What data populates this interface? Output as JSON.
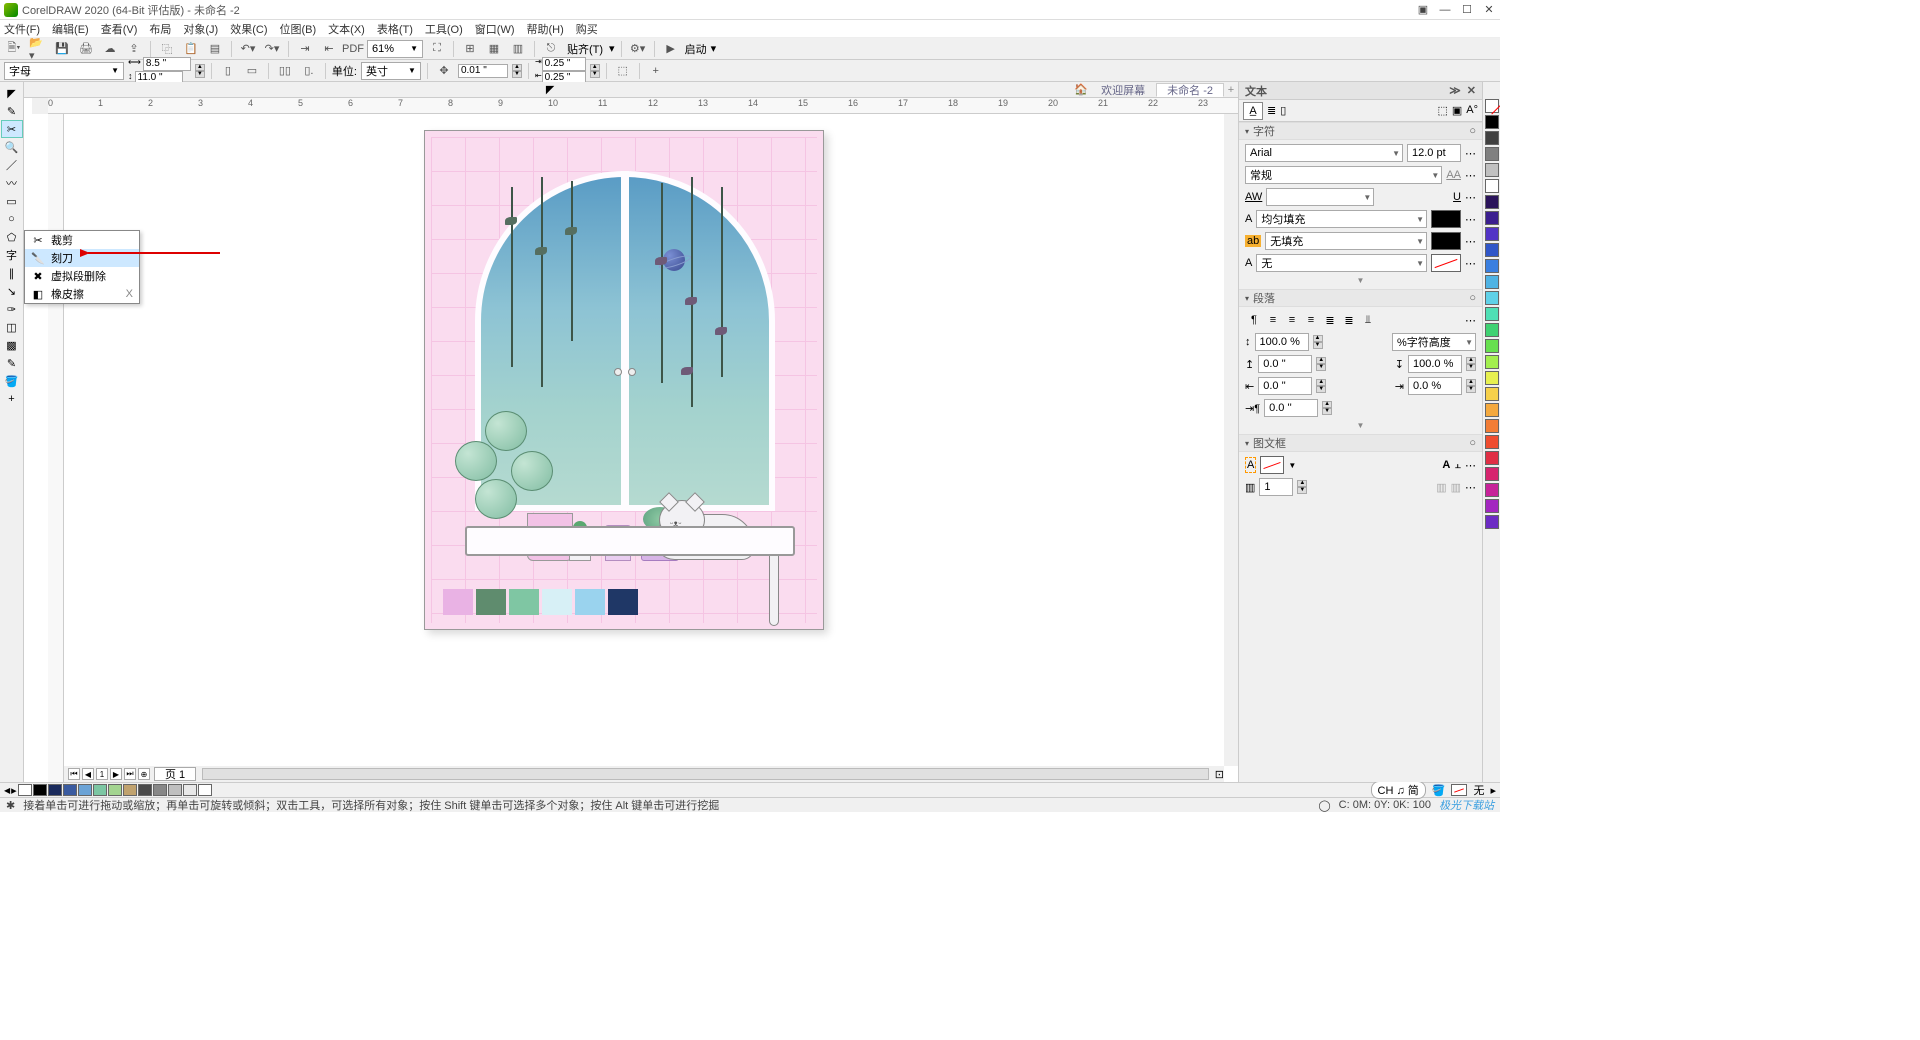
{
  "title": "CorelDRAW 2020 (64-Bit 评估版) - 未命名 -2",
  "menus": [
    "文件(F)",
    "编辑(E)",
    "查看(V)",
    "布局",
    "对象(J)",
    "效果(C)",
    "位图(B)",
    "文本(X)",
    "表格(T)",
    "工具(O)",
    "窗口(W)",
    "帮助(H)",
    "购买"
  ],
  "zoom": "61%",
  "align_label": "贴齐(T)",
  "start_label": "启动",
  "papersize_label": "字母",
  "width": "8.5 \"",
  "height": "11.0 \"",
  "units_label": "单位:",
  "units_value": "英寸",
  "nudge": "0.01 \"",
  "dup_x": "0.25 \"",
  "dup_y": "0.25 \"",
  "tabs": {
    "welcome": "欢迎屏幕",
    "doc": "未命名 -2"
  },
  "flyout": {
    "crop": "裁剪",
    "knife": "刻刀",
    "vdelete": "虚拟段删除",
    "eraser": "橡皮擦",
    "eraser_key": "X"
  },
  "ruler_marks": [
    "0",
    "1",
    "2",
    "3",
    "4",
    "5",
    "6",
    "7",
    "8",
    "9",
    "10",
    "11",
    "12",
    "13",
    "14",
    "15",
    "16",
    "17",
    "18",
    "19",
    "20",
    "21",
    "22",
    "23"
  ],
  "page_tab": "页 1",
  "right": {
    "docker_title": "文本",
    "sec_char": "字符",
    "font": "Arial",
    "font_size": "12.0 pt",
    "font_weight": "常规",
    "kern_label": "AW",
    "fill_label": "均匀填充",
    "nofill_label": "无填充",
    "outline_label": "无",
    "sec_para": "段落",
    "line_spacing": "100.0 %",
    "char_height": "%字符高度",
    "before_para": "0.0 ''",
    "after_para": "100.0 %",
    "indent_left": "0.0 ''",
    "indent_right": "0.0 %",
    "indent_first": "0.0 ''",
    "sec_frame": "图文框",
    "cols": "1"
  },
  "status": {
    "hint": "接着单击可进行拖动或缩放；再单击可旋转或倾斜；双击工具，可选择所有对象；按住 Shift 键单击可选择多个对象；按住 Alt 键单击可进行挖掘",
    "lang": "CH ♫ 简",
    "fill_none": "无",
    "coords": "C: 0M: 0Y: 0K: 100",
    "watermark": "极光下载站"
  },
  "palette_bottom": [
    "#ffffff",
    "#000000",
    "#1a2a5c",
    "#3a5ba0",
    "#6ba3d6",
    "#7cc6a3",
    "#a3d490",
    "#c0a26e",
    "#4a4a4a",
    "#888888",
    "#bfbfbf",
    "#e8e8e8",
    "#ffffff"
  ],
  "swatches": [
    "#e9b2e4",
    "#5f8c6e",
    "#7fc6a3",
    "#d7f0f6",
    "#9ad3ee",
    "#1f3766"
  ],
  "right_palette": [
    "none",
    "#000000",
    "#404040",
    "#808080",
    "#c0c0c0",
    "#ffffff",
    "#2a135a",
    "#3b1f8f",
    "#5234c6",
    "#3056c8",
    "#3a7fe0",
    "#4fb3e4",
    "#5fd1e8",
    "#4fe0b5",
    "#3fd172",
    "#67e04f",
    "#a3ef4f",
    "#e7f050",
    "#f6d04a",
    "#f4a93e",
    "#f27d36",
    "#ef4d30",
    "#e02f45",
    "#d6246e",
    "#c72199",
    "#a327c0",
    "#6d2cc4"
  ]
}
